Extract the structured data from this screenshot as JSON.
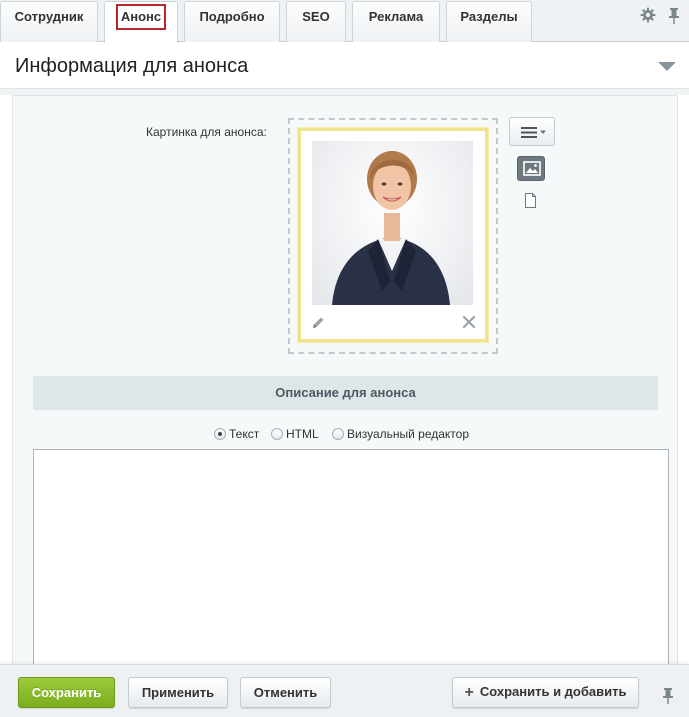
{
  "tabs": [
    {
      "label": "Сотрудник",
      "active": false
    },
    {
      "label": "Анонс",
      "active": true
    },
    {
      "label": "Подробно",
      "active": false
    },
    {
      "label": "SEO",
      "active": false
    },
    {
      "label": "Реклама",
      "active": false
    },
    {
      "label": "Разделы",
      "active": false
    }
  ],
  "section": {
    "title": "Информация для анонса",
    "collapse_icon": "triangle-down-icon"
  },
  "preview_image": {
    "label": "Картинка для анонса:",
    "edit_icon": "pencil-icon",
    "delete_icon": "close-icon",
    "menu_icon": "hamburger-menu-icon",
    "image_mode_icon": "image-icon",
    "file_mode_icon": "document-icon"
  },
  "description": {
    "header": "Описание для анонса",
    "mode_options": [
      {
        "label": "Текст",
        "selected": true
      },
      {
        "label": "HTML",
        "selected": false
      },
      {
        "label": "Визуальный редактор",
        "selected": false
      }
    ],
    "text_value": ""
  },
  "footer": {
    "save": "Сохранить",
    "apply": "Применить",
    "cancel": "Отменить",
    "save_and_add": "Сохранить и добавить",
    "pin_icon": "pin-icon"
  },
  "colors": {
    "primary_green": "#8cbc2c",
    "active_tab_border": "#b3272d",
    "image_frame": "#f1e38a"
  }
}
